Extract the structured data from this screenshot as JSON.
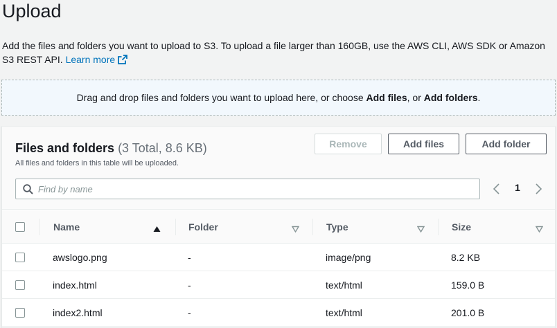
{
  "page": {
    "title": "Upload",
    "description": "Add the files and folders you want to upload to S3. To upload a file larger than 160GB, use the AWS CLI, AWS SDK or Amazon S3 REST API.",
    "learn_more": "Learn more"
  },
  "dropzone": {
    "prefix": "Drag and drop files and folders you want to upload here, or choose ",
    "add_files": "Add files",
    "middle": ", or ",
    "add_folders": "Add folders",
    "suffix": "."
  },
  "panel": {
    "title": "Files and folders",
    "count": "(3 Total, 8.6 KB)",
    "subtitle": "All files and folders in this table will be uploaded.",
    "buttons": {
      "remove": "Remove",
      "add_files": "Add files",
      "add_folder": "Add folder"
    },
    "search": {
      "placeholder": "Find by name",
      "value": ""
    },
    "pagination": {
      "current_page": "1"
    }
  },
  "table": {
    "columns": {
      "name": "Name",
      "folder": "Folder",
      "type": "Type",
      "size": "Size"
    },
    "sort": {
      "column": "Name",
      "direction": "ascending"
    },
    "rows": [
      {
        "name": "awslogo.png",
        "folder": "-",
        "type": "image/png",
        "size": "8.2 KB"
      },
      {
        "name": "index.html",
        "folder": "-",
        "type": "text/html",
        "size": "159.0 B"
      },
      {
        "name": "index2.html",
        "folder": "-",
        "type": "text/html",
        "size": "201.0 B"
      }
    ]
  },
  "colors": {
    "link": "#0073bb",
    "dropzone_bg": "#f2f8fd",
    "page_bg": "#f2f3f3"
  }
}
